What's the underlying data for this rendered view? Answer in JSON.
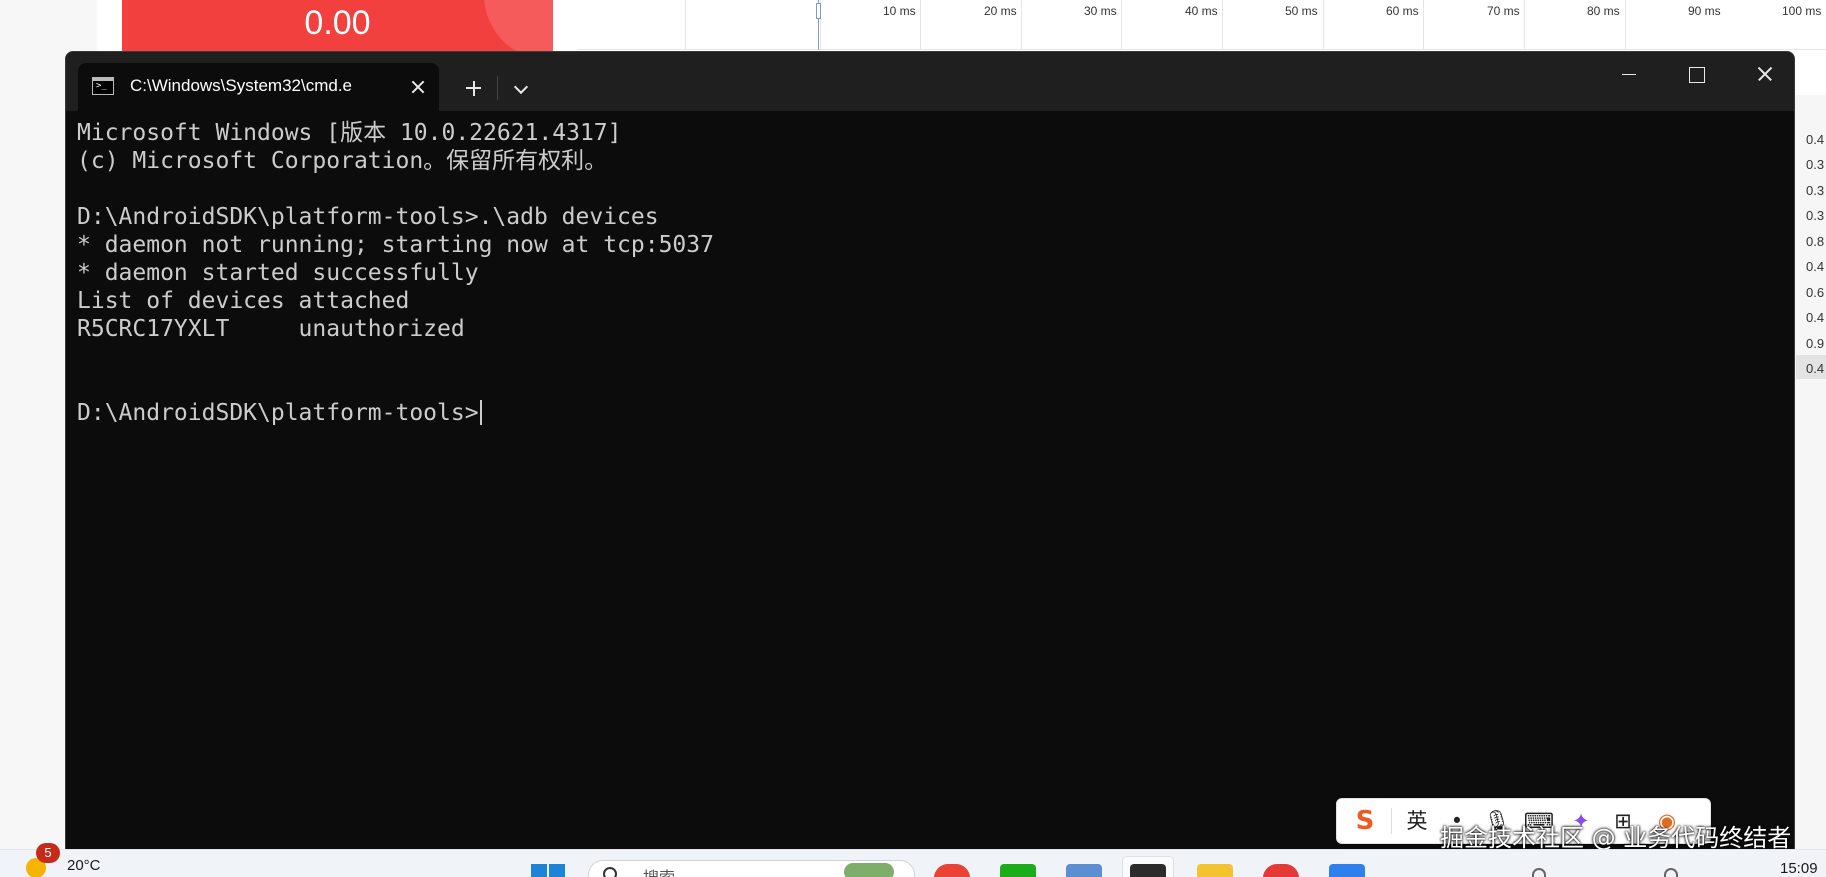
{
  "background_app": {
    "metric_value": "0.00",
    "timeline_ticks": [
      "10 ms",
      "20 ms",
      "30 ms",
      "40 ms",
      "50 ms",
      "60 ms",
      "70 ms",
      "80 ms",
      "90 ms",
      "100 ms"
    ],
    "right_values": [
      "0.4",
      "0.3",
      "0.3",
      "0.3",
      "0.8",
      "0.4",
      "0.6",
      "0.4",
      "0.9",
      "0.4"
    ],
    "accent_color": "#f2403f"
  },
  "terminal": {
    "tab_title": "C:\\Windows\\System32\\cmd.e",
    "lines": [
      "Microsoft Windows [版本 10.0.22621.4317]",
      "(c) Microsoft Corporation。保留所有权利。",
      "",
      "D:\\AndroidSDK\\platform-tools>.\\adb devices",
      "* daemon not running; starting now at tcp:5037",
      "* daemon started successfully",
      "List of devices attached",
      "R5CRC17YXLT     unauthorized",
      "",
      "",
      "D:\\AndroidSDK\\platform-tools>"
    ],
    "background_color": "#0c0c0c",
    "text_color": "#cccccc"
  },
  "ime_toolbar": {
    "logo": "S",
    "mode_label": "英",
    "icons": [
      "punctuation-dot-icon",
      "microphone-icon",
      "keyboard-icon",
      "skin-icon",
      "toolbox-grid-icon",
      "extra-app-icon"
    ]
  },
  "watermark": "掘金技术社区 @ 业务代码终结者",
  "taskbar": {
    "weather_badge": "5",
    "weather_temp": "20°C",
    "search_placeholder": "搜索",
    "clock_time": "15:09",
    "app_icons": [
      "chrome-icon",
      "wechat-icon",
      "calculator-icon",
      "terminal-icon",
      "file-explorer-icon",
      "browser-icon",
      "calendar-icon"
    ]
  }
}
